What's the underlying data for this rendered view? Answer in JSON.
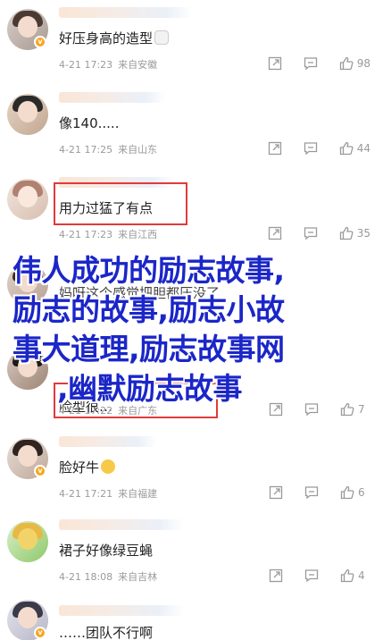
{
  "comments": [
    {
      "text": "好压身高的造型",
      "time": "4-21 17:23",
      "location": "来自安徽",
      "likes": "98",
      "emoji": "mask"
    },
    {
      "text": "像140.....",
      "time": "4-21 17:25",
      "location": "来自山东",
      "likes": "44"
    },
    {
      "text": "用力过猛了有点",
      "time": "4-21 17:23",
      "location": "来自江西",
      "likes": "35"
    },
    {
      "text": "妈呀这个感觉把胆都压没了",
      "time": "",
      "location": "",
      "likes": ""
    },
    {
      "text": "脸型很…",
      "time": "4-21 17:22",
      "location": "来自广东",
      "likes": "7"
    },
    {
      "text": "脸好牛",
      "time": "4-21 17:21",
      "location": "来自福建",
      "likes": "6",
      "emoji": "cry"
    },
    {
      "text": "裙子好像绿豆蝇",
      "time": "4-21 18:08",
      "location": "来自吉林",
      "likes": "4"
    },
    {
      "text": "……团队不行啊",
      "time": "",
      "location": "",
      "likes": ""
    }
  ],
  "overlay": {
    "line1": "伟人成功的励志故事,",
    "line2": "励志的故事,励志小故",
    "line3": "事大道理,励志故事网",
    "line4": ",幽默励志故事"
  },
  "icons": {
    "share": "share-icon",
    "comment": "comment-icon",
    "like": "thumbs-up-icon",
    "verified": "verified-badge-icon"
  },
  "colors": {
    "overlay_text": "#1b26c8",
    "highlight_box": "#e23a3a",
    "meta_gray": "#9a9a9a",
    "verified": "#f5a623"
  }
}
